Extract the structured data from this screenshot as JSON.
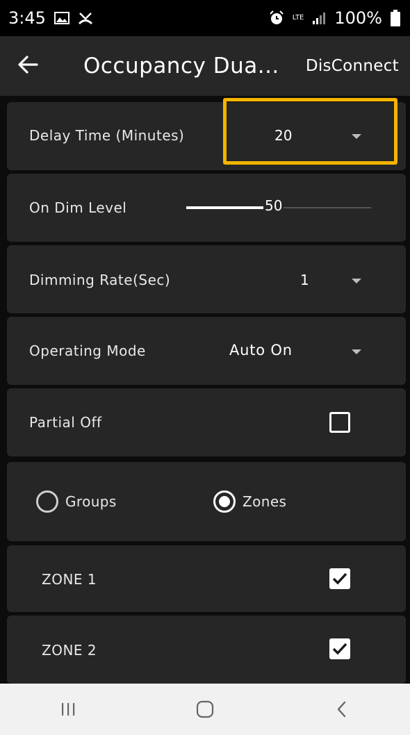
{
  "status_bar": {
    "time": "3:45",
    "network": "LTE",
    "battery": "100%",
    "icons": [
      "image-icon",
      "missed-call-icon",
      "alarm-icon",
      "lte-icon",
      "signal-icon",
      "battery-icon"
    ]
  },
  "app_bar": {
    "back_icon": "arrow-left-icon",
    "title": "Occupancy Dua...",
    "disconnect_label": "DisConnect"
  },
  "settings": {
    "delay_time": {
      "label": "Delay Time (Minutes)",
      "value": "20"
    },
    "on_dim_level": {
      "label": "On Dim Level",
      "value": "50",
      "level_fraction": 0.5
    },
    "dimming_rate": {
      "label": "Dimming Rate(Sec)",
      "value": "1"
    },
    "operating_mode": {
      "label": "Operating Mode",
      "value": "Auto On"
    },
    "partial_off": {
      "label": "Partial Off",
      "checked": false
    }
  },
  "target_selector": {
    "options": [
      {
        "label": "Groups",
        "selected": false
      },
      {
        "label": "Zones",
        "selected": true
      }
    ]
  },
  "zones": [
    {
      "label": "ZONE 1",
      "checked": true
    },
    {
      "label": "ZONE 2",
      "checked": true
    }
  ],
  "nav_bar": {
    "icons": [
      "recent-apps-icon",
      "home-icon",
      "back-icon"
    ]
  },
  "colors": {
    "highlight": "#f5b400",
    "card_bg": "#262626",
    "app_bar_bg": "#272727",
    "nav_bar_bg": "#f1f1f1"
  }
}
